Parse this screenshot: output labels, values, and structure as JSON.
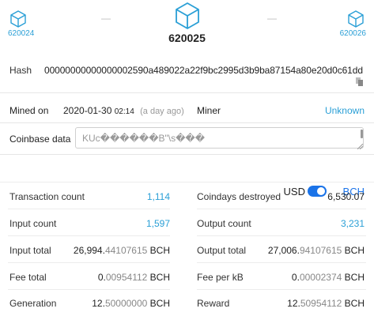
{
  "nav": {
    "prev_block": "620024",
    "current_block": "620025",
    "next_block": "620026",
    "separator": "—"
  },
  "hash": {
    "label": "Hash",
    "value": "00000000000000002590a489022a22f9bc2995d3b9ba87154a80e20d0c61dd"
  },
  "mined": {
    "label": "Mined on",
    "date": "2020-01-30",
    "time": "02:14",
    "ago": "(a day ago)"
  },
  "miner": {
    "label": "Miner",
    "value": "Unknown"
  },
  "coinbase": {
    "label": "Coinbase data",
    "value": "KUc\u0000\u0000\u0000\u0000\u0000\u0000B\"\\s\u0000\u0000\u0000",
    "display": "KUc������B\"\\s���"
  },
  "currency": {
    "usd": "USD",
    "bch": "BCH",
    "selected": "BCH"
  },
  "stats": {
    "transaction_count": {
      "label": "Transaction count",
      "value": "1,114"
    },
    "coindays_destroyed": {
      "label": "Coindays destroyed",
      "value": "6,530.07"
    },
    "input_count": {
      "label": "Input count",
      "value": "1,597"
    },
    "output_count": {
      "label": "Output count",
      "value": "3,231"
    },
    "input_total": {
      "label": "Input total",
      "main": "26,994.",
      "light": "44107615",
      "unit": " BCH"
    },
    "output_total": {
      "label": "Output total",
      "main": "27,006.",
      "light": "94107615",
      "unit": " BCH"
    },
    "fee_total": {
      "label": "Fee total",
      "main": "0.",
      "light": "00954112",
      "unit": " BCH"
    },
    "fee_per_kb": {
      "label": "Fee per kB",
      "main": "0.",
      "light": "00002374",
      "unit": " BCH"
    },
    "generation": {
      "label": "Generation",
      "main": "12.",
      "light": "50000000",
      "unit": " BCH"
    },
    "reward": {
      "label": "Reward",
      "main": "12.",
      "light": "50954112",
      "unit": " BCH"
    }
  },
  "colors": {
    "link": "#2a9fd6",
    "toggle": "#1a73e8"
  }
}
